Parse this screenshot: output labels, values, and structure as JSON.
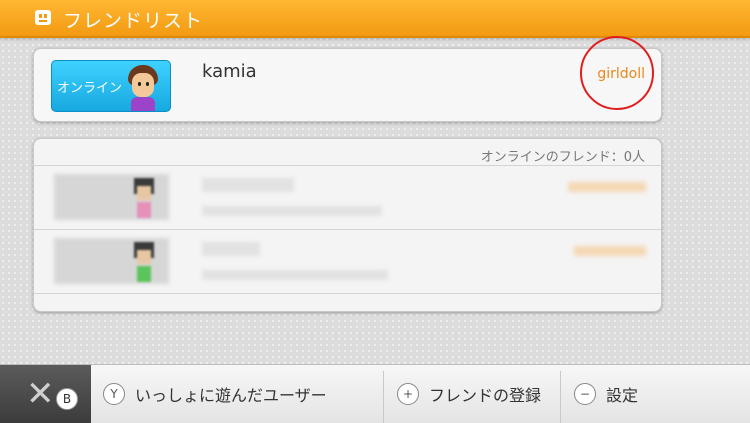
{
  "header": {
    "title": "フレンドリスト",
    "icon": "face-icon"
  },
  "user": {
    "status_label": "オンライン",
    "username": "kamia",
    "mii_name": "girldoll"
  },
  "friend_list": {
    "online_count": "オンラインのフレンド：0人"
  },
  "bottom_bar": {
    "back_button": "B",
    "played_users_button": {
      "glyph": "Y",
      "label": "いっしょに遊んだユーザー"
    },
    "register_friend_button": {
      "glyph": "+",
      "label": "フレンドの登録"
    },
    "settings_button": {
      "glyph": "−",
      "label": "設定"
    }
  },
  "colors": {
    "header": "#f39a12",
    "accent_orange": "#e8891a",
    "highlight_red": "#e01e1e"
  }
}
